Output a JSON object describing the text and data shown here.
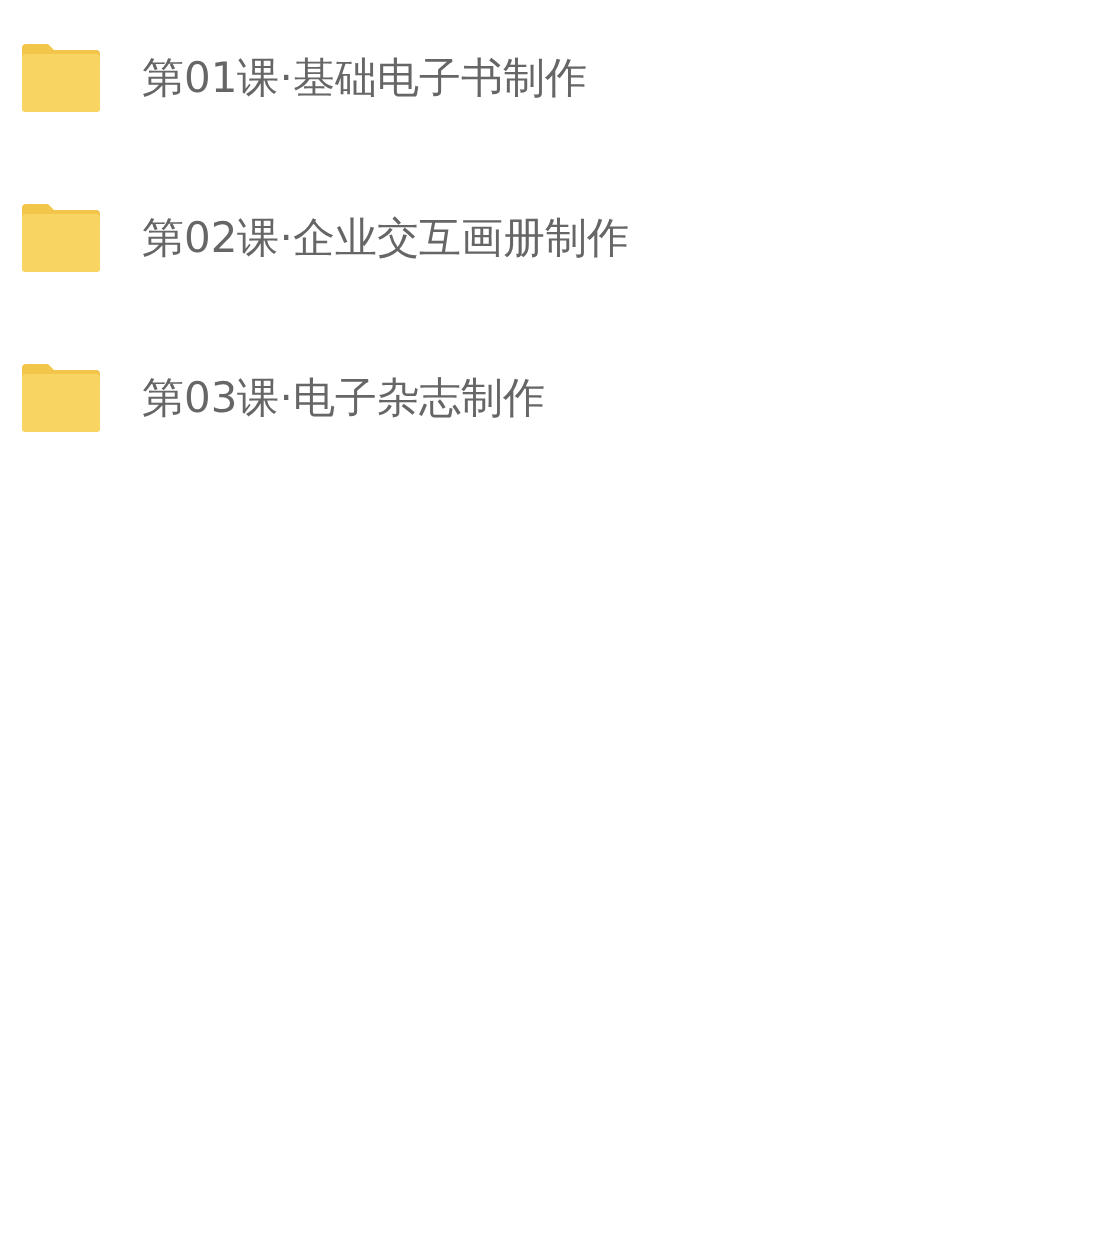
{
  "folders": [
    {
      "name": "第01课·基础电子书制作"
    },
    {
      "name": "第02课·企业交互画册制作"
    },
    {
      "name": "第03课·电子杂志制作"
    }
  ]
}
